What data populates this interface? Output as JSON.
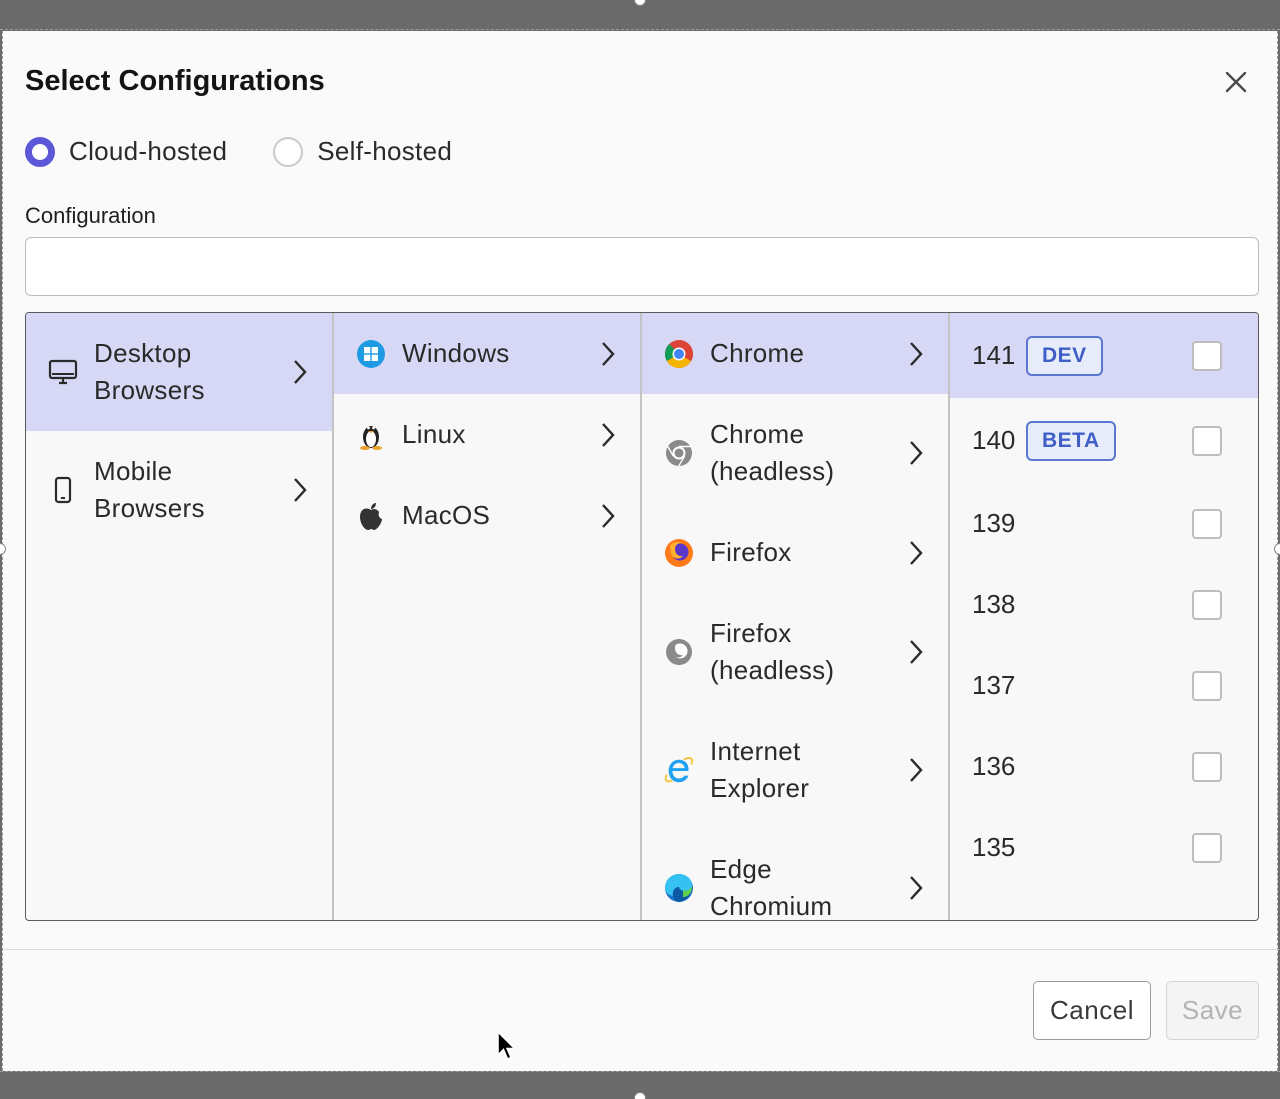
{
  "dialog": {
    "title": "Select Configurations",
    "hosting_options": [
      {
        "label": "Cloud-hosted",
        "checked": true
      },
      {
        "label": "Self-hosted",
        "checked": false
      }
    ],
    "configuration_label": "Configuration",
    "configuration_value": "",
    "configuration_placeholder": ""
  },
  "platform_col": [
    {
      "line1": "Desktop",
      "line2": "Browsers",
      "icon": "monitor-icon",
      "selected": true
    },
    {
      "line1": "Mobile",
      "line2": "Browsers",
      "icon": "phone-icon",
      "selected": false
    }
  ],
  "os_col": [
    {
      "label": "Windows",
      "icon": "windows-icon",
      "selected": true
    },
    {
      "label": "Linux",
      "icon": "linux-icon",
      "selected": false
    },
    {
      "label": "MacOS",
      "icon": "apple-icon",
      "selected": false
    }
  ],
  "browser_col": [
    {
      "line1": "Chrome",
      "line2": "",
      "icon": "chrome-icon",
      "selected": true
    },
    {
      "line1": "Chrome",
      "line2": "(headless)",
      "icon": "chrome-headless-icon",
      "selected": false
    },
    {
      "line1": "Firefox",
      "line2": "",
      "icon": "firefox-icon",
      "selected": false
    },
    {
      "line1": "Firefox",
      "line2": "(headless)",
      "icon": "firefox-headless-icon",
      "selected": false
    },
    {
      "line1": "Internet",
      "line2": "Explorer",
      "icon": "ie-icon",
      "selected": false
    },
    {
      "line1": "Edge",
      "line2": "Chromium",
      "icon": "edge-icon",
      "selected": false
    }
  ],
  "version_col": [
    {
      "version": "141",
      "badge": "DEV",
      "checked": false,
      "selected": true
    },
    {
      "version": "140",
      "badge": "BETA",
      "checked": false,
      "selected": false
    },
    {
      "version": "139",
      "badge": "",
      "checked": false,
      "selected": false
    },
    {
      "version": "138",
      "badge": "",
      "checked": false,
      "selected": false
    },
    {
      "version": "137",
      "badge": "",
      "checked": false,
      "selected": false
    },
    {
      "version": "136",
      "badge": "",
      "checked": false,
      "selected": false
    },
    {
      "version": "135",
      "badge": "",
      "checked": false,
      "selected": false
    }
  ],
  "footer": {
    "cancel_label": "Cancel",
    "save_label": "Save",
    "save_disabled": true
  },
  "colors": {
    "accent": "#5b57d6",
    "selected_row": "#d7d8f5",
    "badge_blue": "#3f5fc7"
  }
}
